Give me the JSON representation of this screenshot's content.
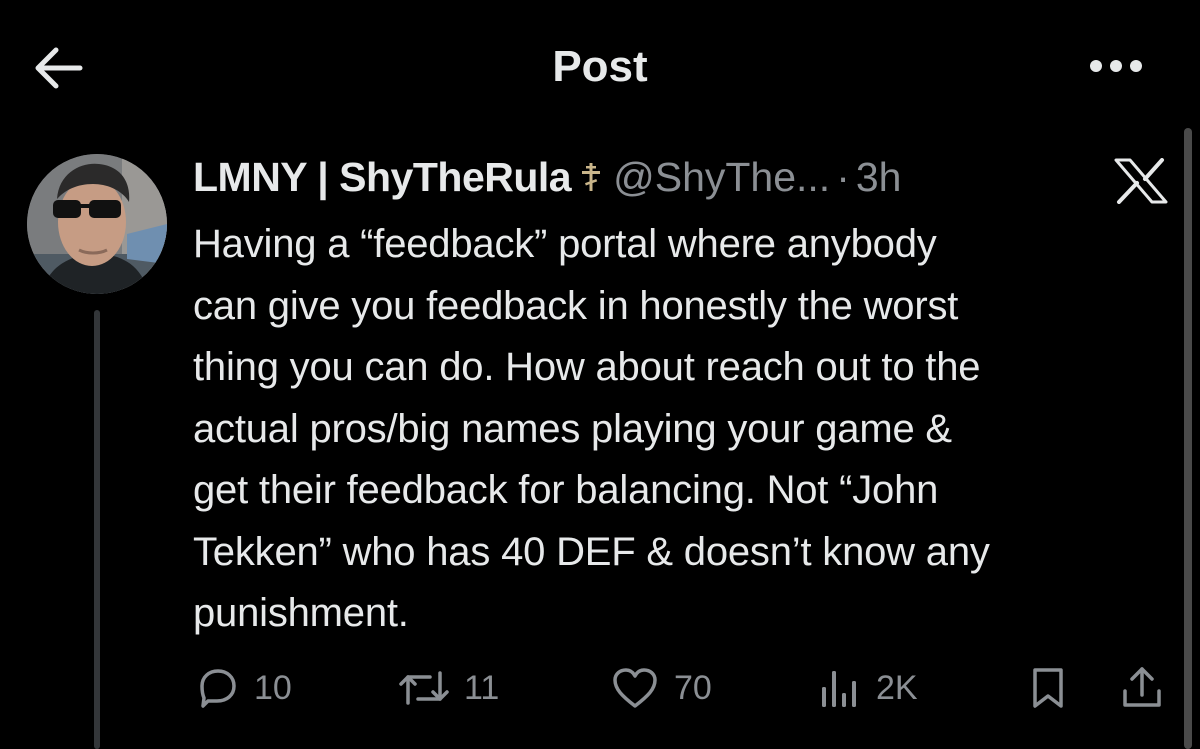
{
  "header": {
    "title": "Post",
    "back_icon": "arrow-left-icon",
    "more_icon": "more-horizontal-icon"
  },
  "post": {
    "display_name": "LMNY | ShyTheRula",
    "name_emoji_icon": "orthodox-cross-icon",
    "handle": "@ShyThe...",
    "separator": "·",
    "timestamp": "3h",
    "platform_icon": "x-logo-icon",
    "text": "Having a “feedback” portal where anybody\ncan give you feedback in honestly the worst\nthing you can do. How about reach out to the\nactual pros/big names playing your game &\nget their feedback for balancing. Not “John\nTekken” who has 40 DEF & doesn’t know any\npunishment."
  },
  "actions": {
    "replies": "10",
    "reposts": "11",
    "likes": "70",
    "views": "2K"
  },
  "colors": {
    "background": "#000000",
    "text_primary": "#e7e9ea",
    "text_secondary": "#8b8f94",
    "thread_line": "#333639"
  }
}
